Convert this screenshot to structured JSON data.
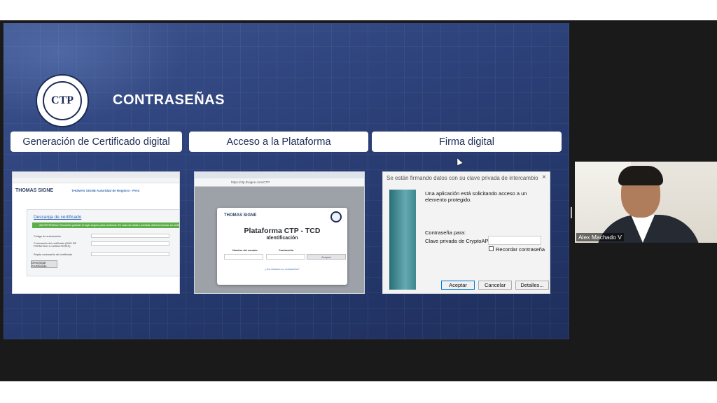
{
  "slide": {
    "title": "CONTRASEÑAS",
    "logo_text": "CTP",
    "steps": [
      {
        "label": "Generación de Certificado digital"
      },
      {
        "label": "Acceso a la Plataforma"
      },
      {
        "label": "Firma digital"
      }
    ]
  },
  "shot1": {
    "brand": "THOMAS SIGNE",
    "header_sub": "THOMAS SIGNE Autoridad de Registro - Perú",
    "link": "Descarga de certificado",
    "alert": "ADVERTENCIA: Recuerde guardar el login seguro para continuar. En caso de duda o pérdida, deberá revocar su certificado y generar uno nuevo.",
    "rows": [
      "Código de autorización",
      "Contraseña del certificado (MÁS DE PERMITIDO 8 CARACTERES)",
      "Repita contraseña del certificado"
    ],
    "button": "Descargar Certificado"
  },
  "shot2": {
    "url": "https://ctp.thsigne.com/CTP",
    "brand": "THOMAS SIGNE",
    "title": "Plataforma CTP - TCD",
    "subtitle": "Identificación",
    "user_label": "Nombre del usuario",
    "pass_label": "Contraseña",
    "accept": "Aceptar",
    "forgot": "¿Ha olvidado su contraseña?"
  },
  "shot3": {
    "dialog_title": "Se están firmando datos con su clave privada de intercambio",
    "close": "×",
    "message": "Una aplicación está solicitando acceso a un elemento protegido.",
    "password_for": "Contraseña para:",
    "key_label": "Clave privada de CryptoAP",
    "remember": "Recordar contraseña",
    "buttons": [
      "Aceptar",
      "Cancelar",
      "Detalles..."
    ]
  },
  "controls": [
    {
      "icon": "previous-icon",
      "glyph": "◀"
    },
    {
      "icon": "next-icon",
      "glyph": "▶"
    },
    {
      "icon": "pen-icon",
      "glyph": "✎"
    },
    {
      "icon": "slides-icon",
      "glyph": "▦"
    },
    {
      "icon": "zoom-icon",
      "glyph": "⌕"
    },
    {
      "icon": "subtitles-icon",
      "glyph": "▭"
    },
    {
      "icon": "camera-icon",
      "glyph": "▶"
    },
    {
      "icon": "more-icon",
      "glyph": "⋯"
    }
  ],
  "participant": {
    "name": "Alex Machado V"
  }
}
